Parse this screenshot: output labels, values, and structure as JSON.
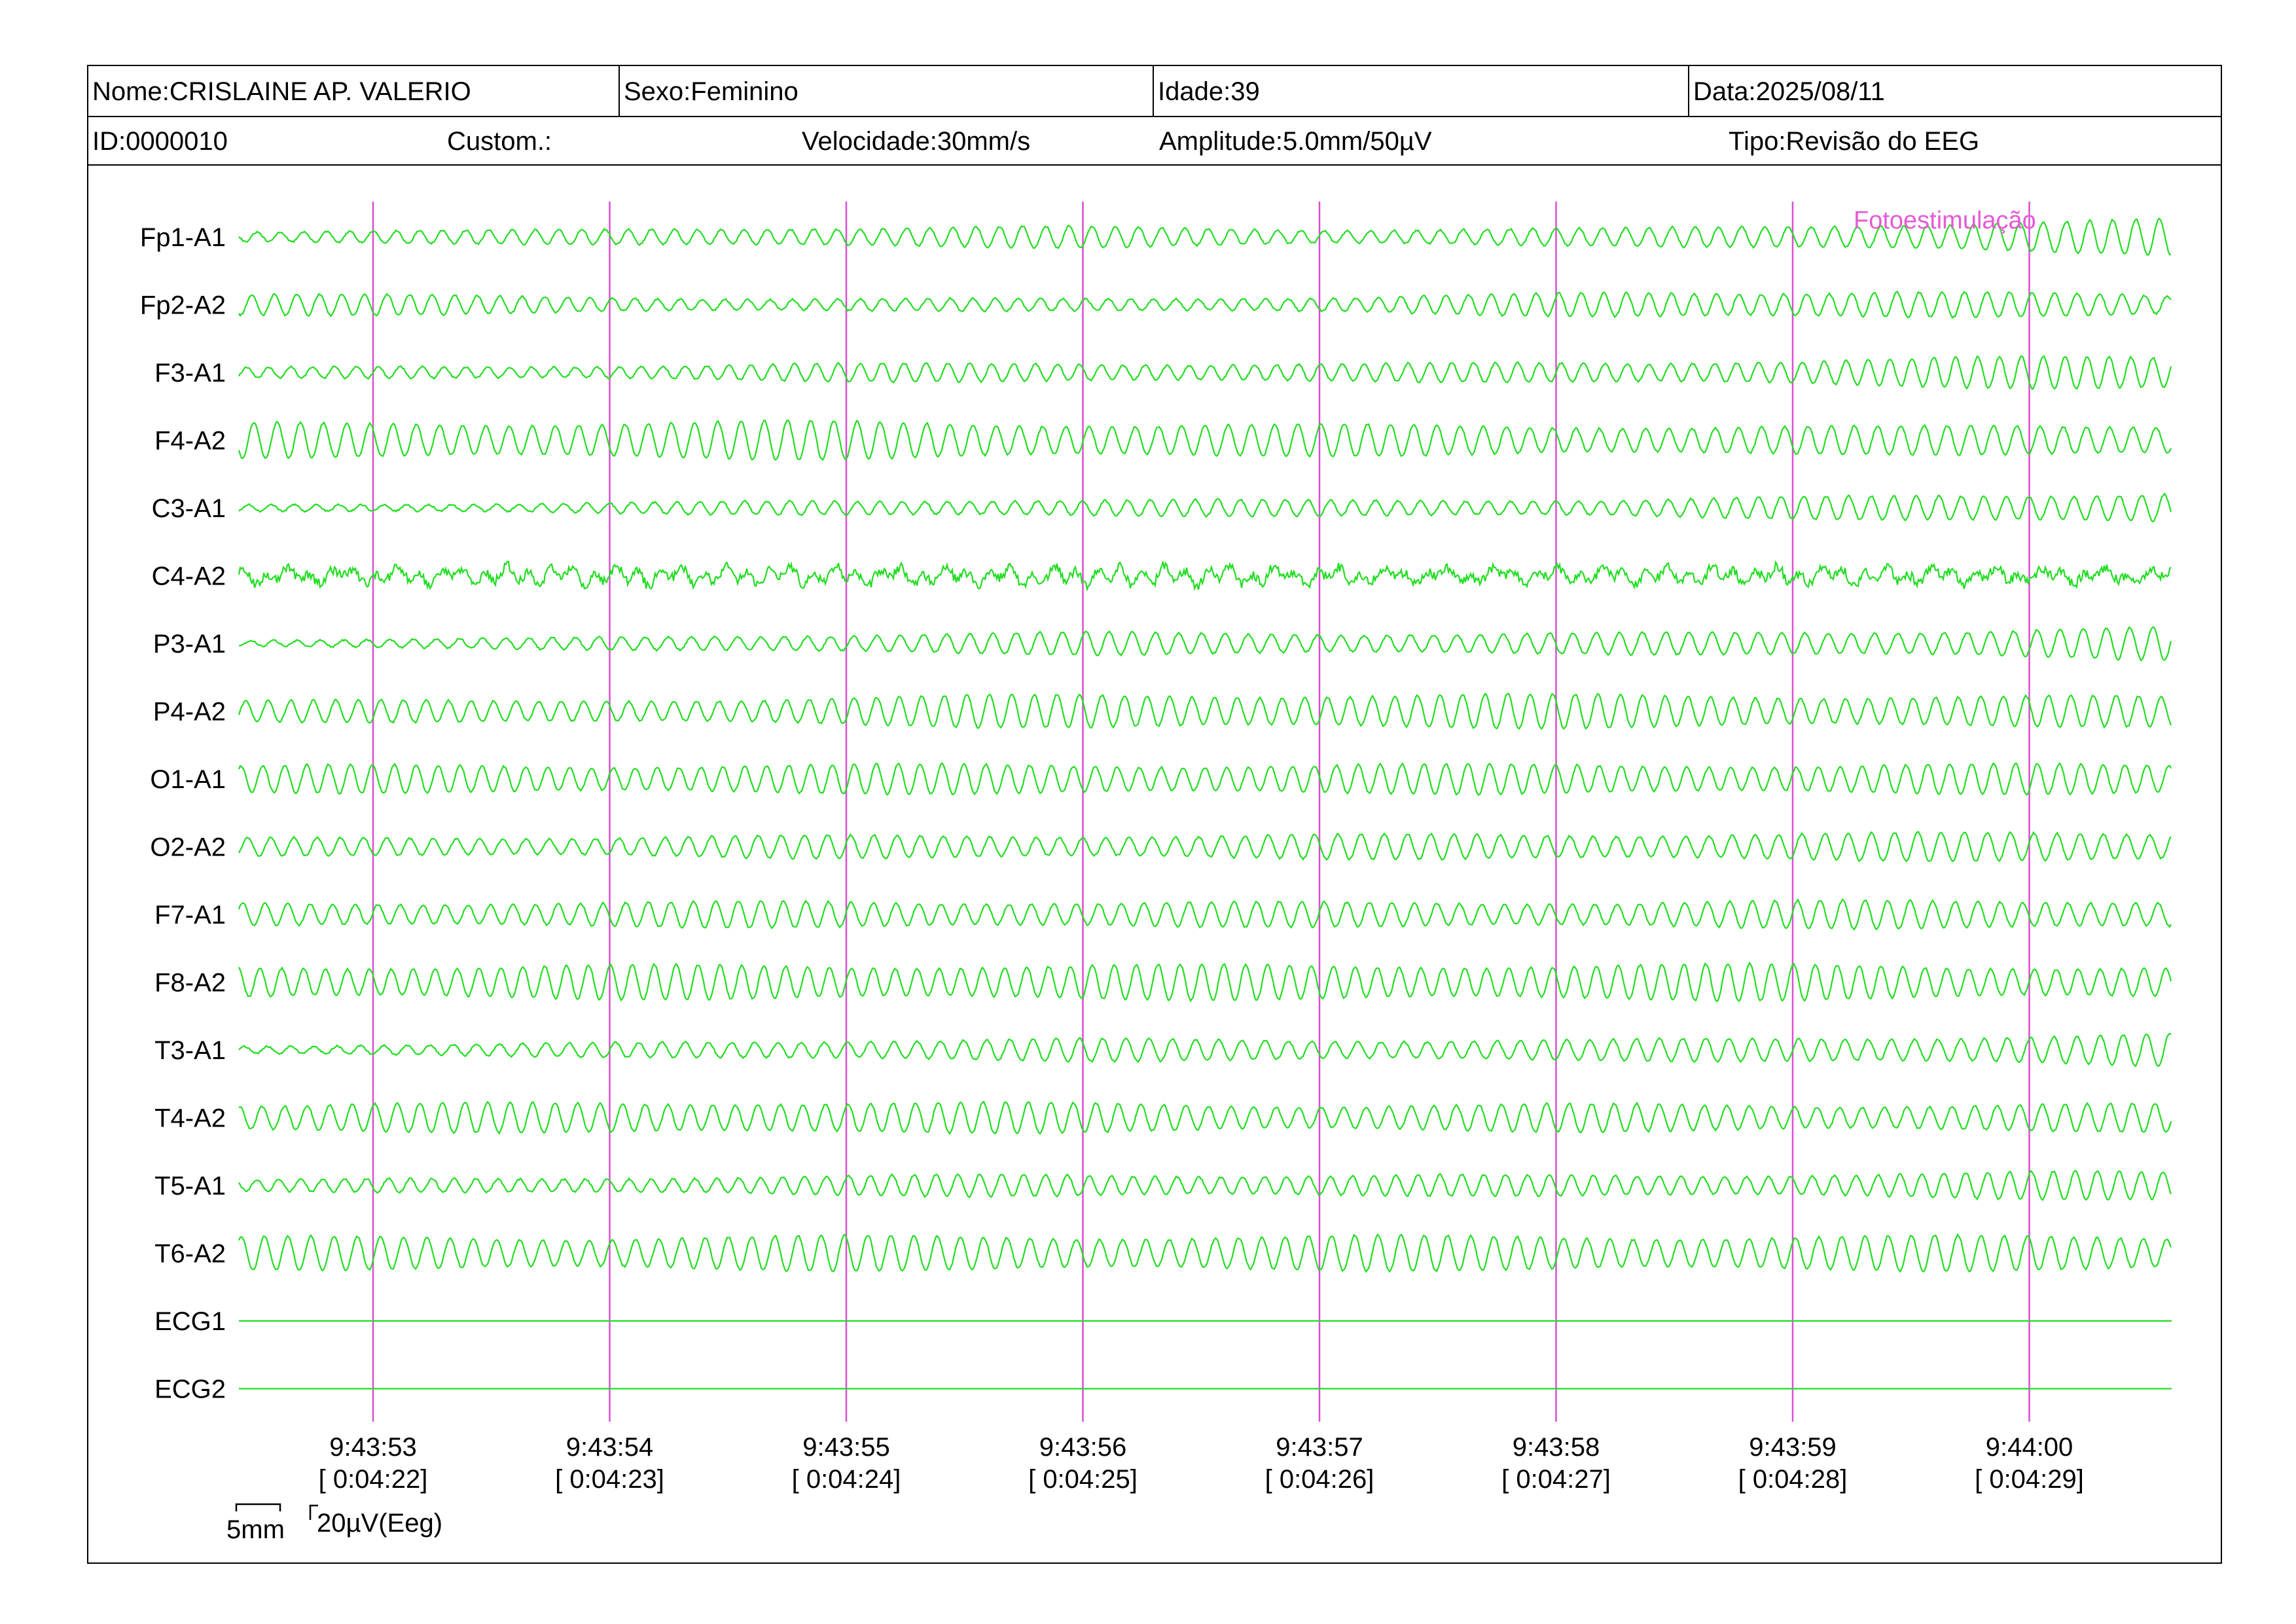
{
  "header": {
    "name": "Nome:CRISLAINE AP. VALERIO",
    "sex": "Sexo:Feminino",
    "age": "Idade:39",
    "date": "Data:2025/08/11",
    "id": "ID:0000010",
    "custom": "Custom.:",
    "speed": "Velocidade:30mm/s",
    "amplitude": "Amplitude:5.0mm/50µV",
    "type": "Tipo:Revisão do EEG"
  },
  "event_label": "Fotoestimulação",
  "scale": {
    "time_label": "5mm",
    "amp_label": "20µV(Eeg)"
  },
  "colors": {
    "trace": "#22dd22",
    "marker": "#d94fd0",
    "event": "#e55ad7"
  },
  "chart_data": {
    "type": "line",
    "title": "",
    "xlabel": "",
    "ylabel": "",
    "x_ticks": [
      {
        "time": "9:43:53",
        "elapsed": "[ 0:04:22]"
      },
      {
        "time": "9:43:54",
        "elapsed": "[ 0:04:23]"
      },
      {
        "time": "9:43:55",
        "elapsed": "[ 0:04:24]"
      },
      {
        "time": "9:43:56",
        "elapsed": "[ 0:04:25]"
      },
      {
        "time": "9:43:57",
        "elapsed": "[ 0:04:26]"
      },
      {
        "time": "9:43:58",
        "elapsed": "[ 0:04:27]"
      },
      {
        "time": "9:43:59",
        "elapsed": "[ 0:04:28]"
      },
      {
        "time": "9:44:00",
        "elapsed": "[ 0:04:29]"
      }
    ],
    "channels": [
      {
        "name": "Fp1-A1",
        "profile": [
          0.35,
          0.4,
          0.55,
          0.6,
          0.45,
          0.5,
          0.8,
          1.0
        ]
      },
      {
        "name": "Fp2-A2",
        "profile": [
          0.7,
          0.5,
          0.35,
          0.35,
          0.45,
          0.7,
          0.85,
          0.5
        ]
      },
      {
        "name": "F3-A1",
        "profile": [
          0.3,
          0.35,
          0.5,
          0.55,
          0.5,
          0.6,
          0.8,
          1.0
        ]
      },
      {
        "name": "F4-A2",
        "profile": [
          1.0,
          1.05,
          1.1,
          1.0,
          0.9,
          0.85,
          0.8,
          0.95
        ]
      },
      {
        "name": "C3-A1",
        "profile": [
          0.2,
          0.25,
          0.4,
          0.5,
          0.45,
          0.5,
          0.7,
          0.95
        ]
      },
      {
        "name": "C4-A2",
        "profile": [
          0.45,
          0.6,
          0.65,
          0.7,
          0.5,
          0.5,
          0.55,
          0.5
        ],
        "irregular": true
      },
      {
        "name": "P3-A1",
        "profile": [
          0.2,
          0.3,
          0.5,
          0.65,
          0.6,
          0.6,
          0.75,
          0.95
        ]
      },
      {
        "name": "P4-A2",
        "profile": [
          0.75,
          0.55,
          0.8,
          0.95,
          1.0,
          0.95,
          0.9,
          0.85
        ]
      },
      {
        "name": "O1-A1",
        "profile": [
          0.8,
          0.8,
          0.85,
          0.85,
          0.85,
          0.85,
          0.85,
          0.85
        ]
      },
      {
        "name": "O2-A2",
        "profile": [
          0.5,
          0.55,
          0.65,
          0.65,
          0.7,
          0.75,
          0.8,
          0.85
        ]
      },
      {
        "name": "F7-A1",
        "profile": [
          0.65,
          0.7,
          0.75,
          0.75,
          0.7,
          0.75,
          0.8,
          0.85
        ]
      },
      {
        "name": "F8-A2",
        "profile": [
          0.95,
          0.95,
          1.0,
          1.0,
          1.0,
          1.05,
          1.0,
          0.9
        ]
      },
      {
        "name": "T3-A1",
        "profile": [
          0.25,
          0.35,
          0.55,
          0.65,
          0.6,
          0.6,
          0.75,
          0.95
        ]
      },
      {
        "name": "T4-A2",
        "profile": [
          0.8,
          0.85,
          0.95,
          0.85,
          0.75,
          0.8,
          0.75,
          0.8
        ]
      },
      {
        "name": "T5-A1",
        "profile": [
          0.35,
          0.4,
          0.55,
          0.65,
          0.6,
          0.6,
          0.7,
          0.85
        ]
      },
      {
        "name": "T6-A2",
        "profile": [
          0.95,
          0.95,
          1.0,
          1.0,
          1.0,
          1.0,
          1.0,
          1.0
        ]
      },
      {
        "name": "ECG1",
        "profile": [
          0,
          0,
          0,
          0,
          0,
          0,
          0,
          0
        ]
      },
      {
        "name": "ECG2",
        "profile": [
          0,
          0,
          0,
          0,
          0,
          0,
          0,
          0
        ]
      }
    ]
  }
}
